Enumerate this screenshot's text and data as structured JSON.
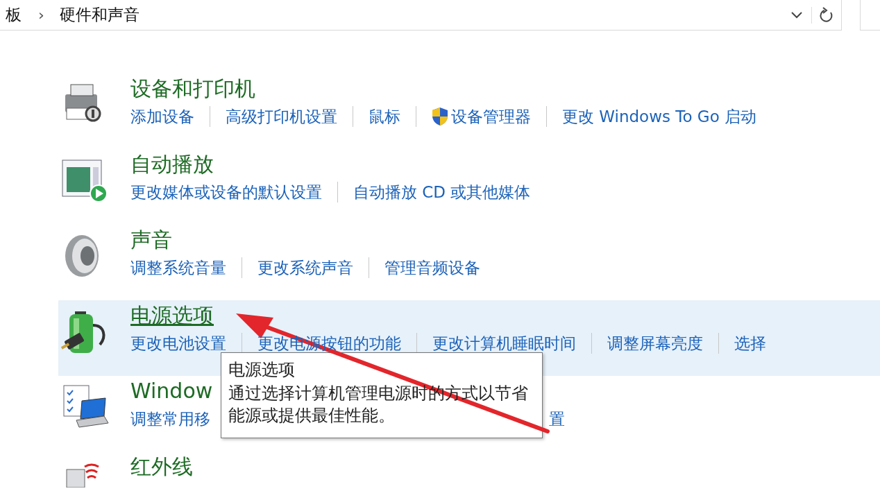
{
  "address_bar": {
    "path": [
      {
        "label": "板"
      },
      {
        "label": "硬件和声音"
      }
    ],
    "separator": "›"
  },
  "categories": [
    {
      "title": "设备和打印机",
      "hovered": false,
      "links": [
        {
          "label": "添加设备",
          "shield": false
        },
        {
          "label": "高级打印机设置",
          "shield": false
        },
        {
          "label": "鼠标",
          "shield": false
        },
        {
          "label": "设备管理器",
          "shield": true
        },
        {
          "label": "更改 Windows To Go 启动",
          "shield": false
        }
      ]
    },
    {
      "title": "自动播放",
      "hovered": false,
      "links": [
        {
          "label": "更改媒体或设备的默认设置",
          "shield": false
        },
        {
          "label": "自动播放 CD 或其他媒体",
          "shield": false
        }
      ]
    },
    {
      "title": "声音",
      "hovered": false,
      "links": [
        {
          "label": "调整系统音量",
          "shield": false
        },
        {
          "label": "更改系统声音",
          "shield": false
        },
        {
          "label": "管理音频设备",
          "shield": false
        }
      ]
    },
    {
      "title": "电源选项",
      "hovered": true,
      "links": [
        {
          "label": "更改电池设置",
          "shield": false
        },
        {
          "label": "更改电源按钮的功能",
          "shield": false
        },
        {
          "label": "更改计算机睡眠时间",
          "shield": false
        },
        {
          "label": "调整屏幕亮度",
          "shield": false
        },
        {
          "label": "选择",
          "shield": false
        }
      ]
    },
    {
      "title": "Window",
      "hovered": false,
      "links": [
        {
          "label": "调整常用移",
          "shield": false
        },
        {
          "label": "置",
          "shield": false
        }
      ]
    },
    {
      "title": "红外线",
      "hovered": false
    }
  ],
  "tooltip": {
    "title": "电源选项",
    "text": "通过选择计算机管理电源时的方式以节省能源或提供最佳性能。"
  }
}
